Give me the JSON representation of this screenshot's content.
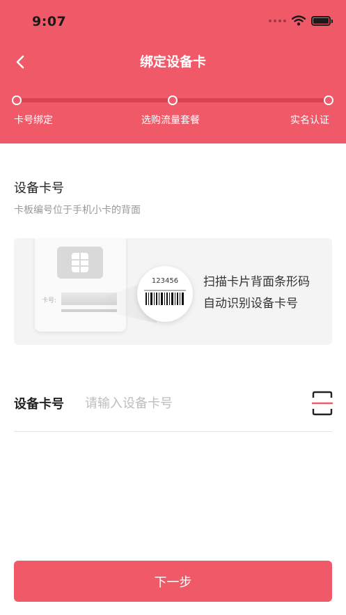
{
  "status_bar": {
    "time": "9:07"
  },
  "nav": {
    "title": "绑定设备卡"
  },
  "steps": [
    {
      "label": "卡号绑定"
    },
    {
      "label": "选购流量套餐"
    },
    {
      "label": "实名认证"
    }
  ],
  "section": {
    "title": "设备卡号",
    "hint": "卡板编号位于手机小卡的背面"
  },
  "illustration": {
    "sim_label": "卡号:",
    "barcode_number": "123456",
    "scan_line1": "扫描卡片背面条形码",
    "scan_line2": "自动识别设备卡号"
  },
  "form": {
    "label": "设备卡号",
    "value": "",
    "placeholder": "请输入设备卡号"
  },
  "footer": {
    "next_label": "下一步"
  },
  "colors": {
    "accent": "#F05A68",
    "track": "#D9434F",
    "background": "#FFFFFF",
    "card_bg": "#F4F4F4"
  },
  "icons": {
    "back": "chevron-left-icon",
    "wifi": "wifi-icon",
    "battery": "battery-icon",
    "scan": "scan-icon"
  }
}
